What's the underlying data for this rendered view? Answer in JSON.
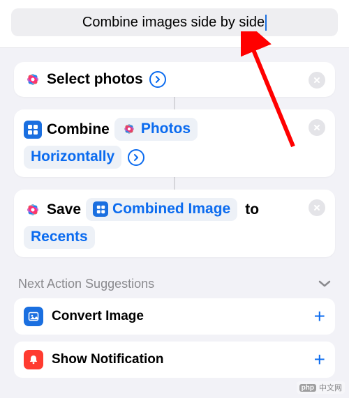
{
  "title": "Combine images side by side",
  "actions": {
    "select_photos": {
      "label": "Select photos"
    },
    "combine": {
      "label": "Combine",
      "param1": "Photos",
      "param2": "Horizontally"
    },
    "save": {
      "label": "Save",
      "param1": "Combined Image",
      "to_label": "to",
      "param2": "Recents"
    }
  },
  "suggestions_header": "Next Action Suggestions",
  "suggestions": [
    {
      "label": "Convert Image",
      "icon": "image",
      "color": "blue"
    },
    {
      "label": "Show Notification",
      "icon": "bell",
      "color": "red"
    }
  ],
  "watermark": {
    "logo": "php",
    "text": "中文网"
  }
}
